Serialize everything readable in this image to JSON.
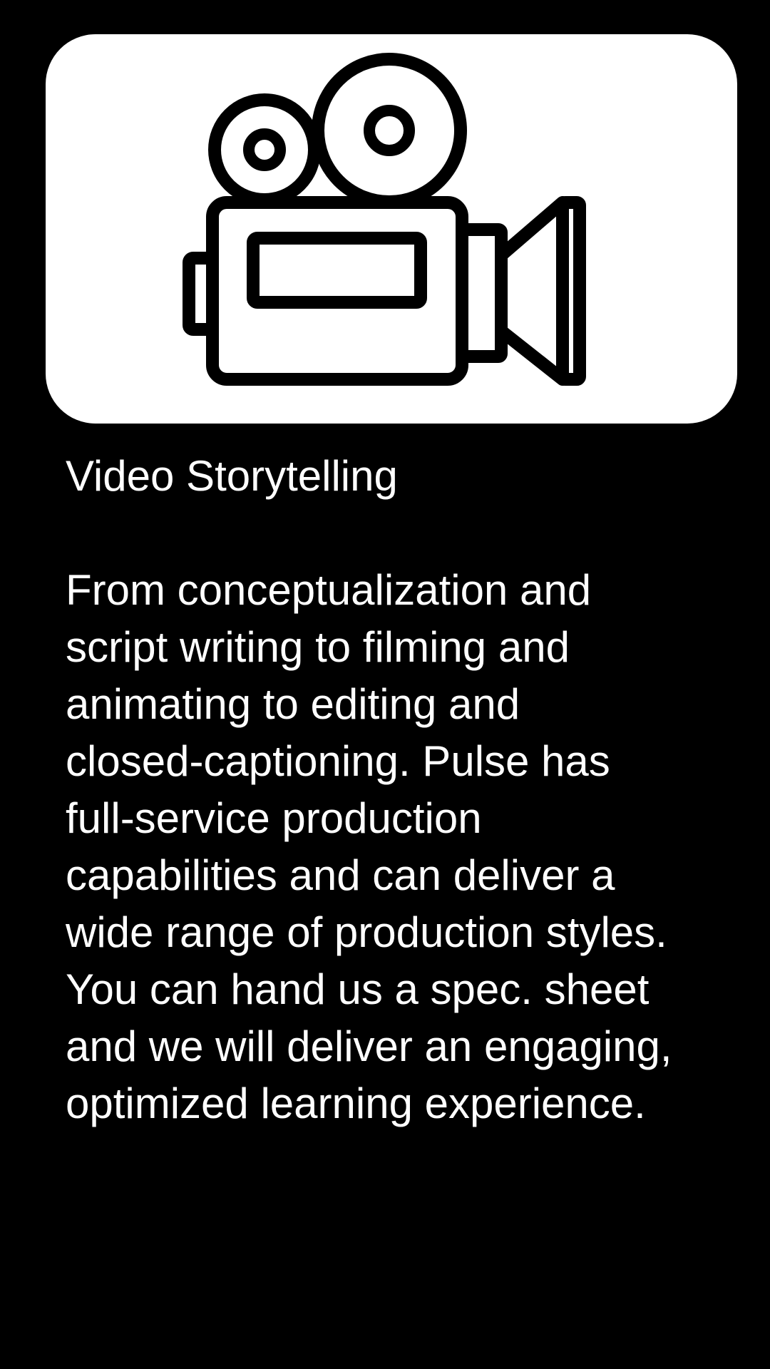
{
  "card": {
    "icon": "video-camera-icon",
    "background_color": "#ffffff",
    "icon_color": "#000000"
  },
  "title": "Video Storytelling",
  "description_lines": [
    "From conceptualization and",
    "script writing to filming and",
    "animating to editing and",
    "closed-captioning. Pulse has",
    "full-service production",
    "capabilities and can deliver a",
    "wide range of production styles.",
    "You can hand us a spec. sheet",
    "and we will deliver an engaging,",
    "optimized learning experience."
  ],
  "colors": {
    "background": "#000000",
    "text": "#ffffff"
  }
}
